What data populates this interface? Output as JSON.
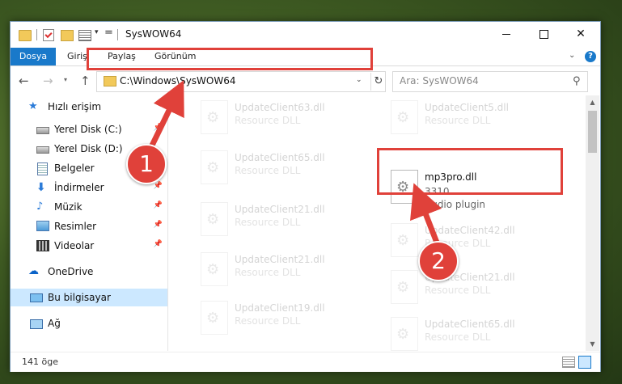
{
  "window": {
    "title": "SysWOW64",
    "quick_access_eq": "="
  },
  "ribbon": {
    "tabs": [
      "Dosya",
      "Giriş",
      "Paylaş",
      "Görünüm"
    ],
    "help": "?"
  },
  "navbar": {
    "address": "C:\\Windows\\SysWOW64",
    "search_placeholder": "Ara: SysWOW64"
  },
  "sidebar": {
    "items": [
      {
        "label": "Hızlı erişim",
        "icon": "star-icon",
        "pinned": false
      },
      {
        "label": "Yerel Disk (C:)",
        "icon": "drive-icon",
        "pinned": false
      },
      {
        "label": "Yerel Disk (D:)",
        "icon": "drive-icon",
        "pinned": false
      },
      {
        "label": "Belgeler",
        "icon": "documents-icon",
        "pinned": false
      },
      {
        "label": "İndirmeler",
        "icon": "download-icon",
        "pinned": true
      },
      {
        "label": "Müzik",
        "icon": "music-icon",
        "pinned": true
      },
      {
        "label": "Resimler",
        "icon": "pictures-icon",
        "pinned": true
      },
      {
        "label": "Videolar",
        "icon": "video-icon",
        "pinned": true
      },
      {
        "label": "OneDrive",
        "icon": "cloud-icon",
        "pinned": false
      },
      {
        "label": "Bu bilgisayar",
        "icon": "computer-icon",
        "pinned": false,
        "selected": true
      },
      {
        "label": "Ağ",
        "icon": "network-icon",
        "pinned": false
      }
    ]
  },
  "files": {
    "left": [
      {
        "name": "UpdateClient63.dll",
        "sub": "Resource DLL"
      },
      {
        "name": "UpdateClient65.dll",
        "sub": "Resource DLL"
      },
      {
        "name": "UpdateClient21.dll",
        "sub": "Resource DLL"
      },
      {
        "name": "UpdateClient21.dll",
        "sub": "Resource DLL"
      },
      {
        "name": "UpdateClient19.dll",
        "sub": "Resource DLL"
      }
    ],
    "right": [
      {
        "name": "UpdateClient5.dll",
        "sub": "Resource DLL"
      },
      {
        "name": "UpdateClient42.dll",
        "sub": "Resource DLL"
      },
      {
        "name": "UpdateClient21.dll",
        "sub": "Resource DLL"
      },
      {
        "name": "UpdateClient65.dll",
        "sub": "Resource DLL"
      }
    ],
    "highlighted": {
      "name": "mp3pro.dll",
      "size": "3310",
      "desc": "Audio plugin"
    }
  },
  "status": {
    "count": "141 öge"
  },
  "annotations": {
    "badge1": "1",
    "badge2": "2",
    "color": "#e0413a"
  }
}
